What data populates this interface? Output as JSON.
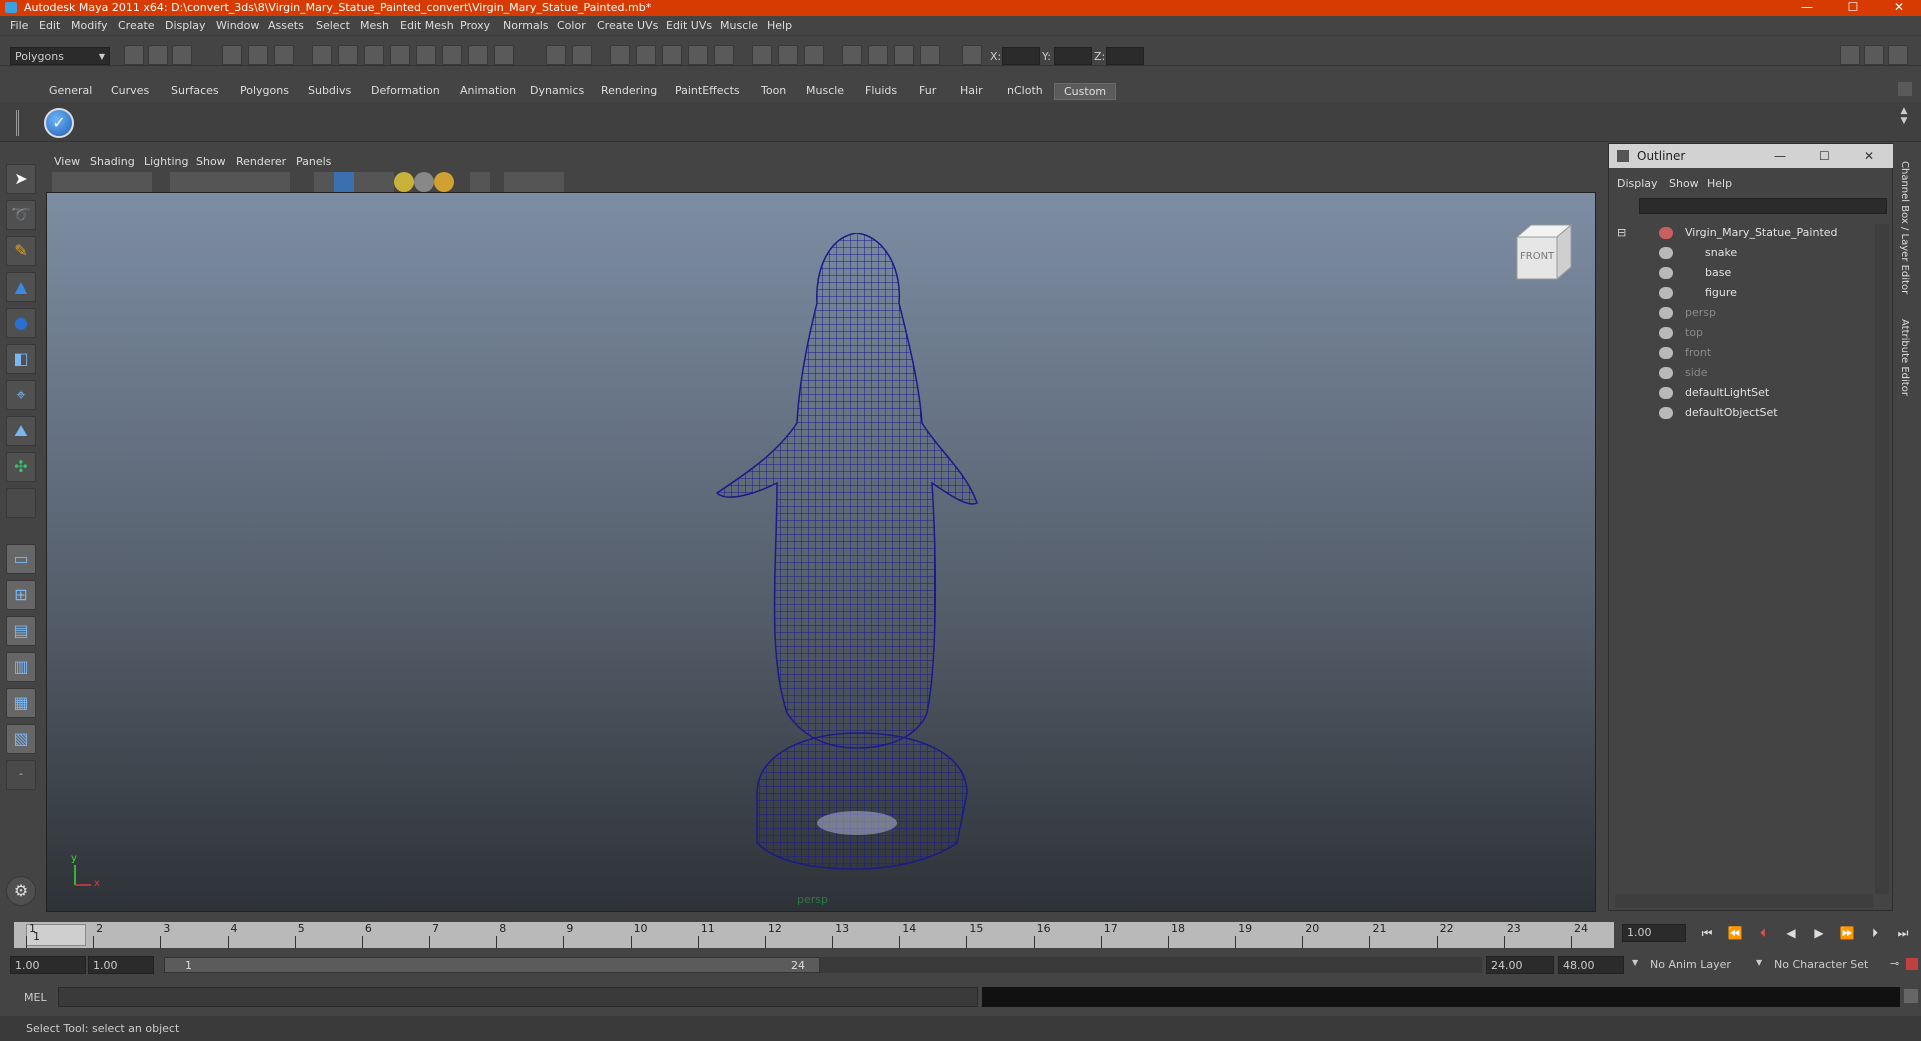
{
  "window": {
    "title": "Autodesk Maya 2011 x64: D:\\convert_3ds\\8\\Virgin_Mary_Statue_Painted_convert\\Virgin_Mary_Statue_Painted.mb*",
    "controls": [
      "—",
      "☐",
      "✕"
    ],
    "title_bar_color": "#d83b01"
  },
  "menubar": [
    "File",
    "Edit",
    "Modify",
    "Create",
    "Display",
    "Window",
    "Assets",
    "Select",
    "Mesh",
    "Edit Mesh",
    "Proxy",
    "Normals",
    "Color",
    "Create UVs",
    "Edit UVs",
    "Muscle",
    "Help"
  ],
  "statusline": {
    "mode": "Polygons",
    "x_label": "X:",
    "y_label": "Y:",
    "z_label": "Z:"
  },
  "shelf": {
    "tabs": [
      "General",
      "Curves",
      "Surfaces",
      "Polygons",
      "Subdivs",
      "Deformation",
      "Animation",
      "Dynamics",
      "Rendering",
      "PaintEffects",
      "Toon",
      "Muscle",
      "Fluids",
      "Fur",
      "Hair",
      "nCloth",
      "Custom"
    ],
    "active_tab": "Custom"
  },
  "viewport": {
    "menus": [
      "View",
      "Shading",
      "Lighting",
      "Show",
      "Renderer",
      "Panels"
    ],
    "camera_label": "persp",
    "viewcube_face": "FRONT",
    "axis_y": "y",
    "axis_x": "x",
    "wire_color": "#1a1a8a"
  },
  "outliner": {
    "title": "Outliner",
    "menus": [
      "Display",
      "Show",
      "Help"
    ],
    "items": [
      {
        "label": "Virgin_Mary_Statue_Painted",
        "indent": 0,
        "dim": false
      },
      {
        "label": "snake",
        "indent": 1,
        "dim": false
      },
      {
        "label": "base",
        "indent": 1,
        "dim": false
      },
      {
        "label": "figure",
        "indent": 1,
        "dim": false
      },
      {
        "label": "persp",
        "indent": 0,
        "dim": true
      },
      {
        "label": "top",
        "indent": 0,
        "dim": true
      },
      {
        "label": "front",
        "indent": 0,
        "dim": true
      },
      {
        "label": "side",
        "indent": 0,
        "dim": true
      },
      {
        "label": "defaultLightSet",
        "indent": 0,
        "dim": false
      },
      {
        "label": "defaultObjectSet",
        "indent": 0,
        "dim": false
      }
    ]
  },
  "side_tabs": [
    "Channel Box / Layer Editor",
    "Attribute Editor"
  ],
  "timeline": {
    "ticks": [
      "1",
      "2",
      "3",
      "4",
      "5",
      "6",
      "7",
      "8",
      "9",
      "10",
      "11",
      "12",
      "13",
      "14",
      "15",
      "16",
      "17",
      "18",
      "19",
      "20",
      "21",
      "22",
      "23",
      "24"
    ],
    "current_frame": "1.00",
    "current_marker": "1"
  },
  "range": {
    "start": "1.00",
    "anim_start": "1.00",
    "slider_left": "1",
    "slider_right": "24",
    "anim_end": "24.00",
    "end": "48.00",
    "anim_layer": "No Anim Layer",
    "character_set": "No Character Set"
  },
  "mel": {
    "label": "MEL"
  },
  "help_line": "Select Tool: select an object"
}
